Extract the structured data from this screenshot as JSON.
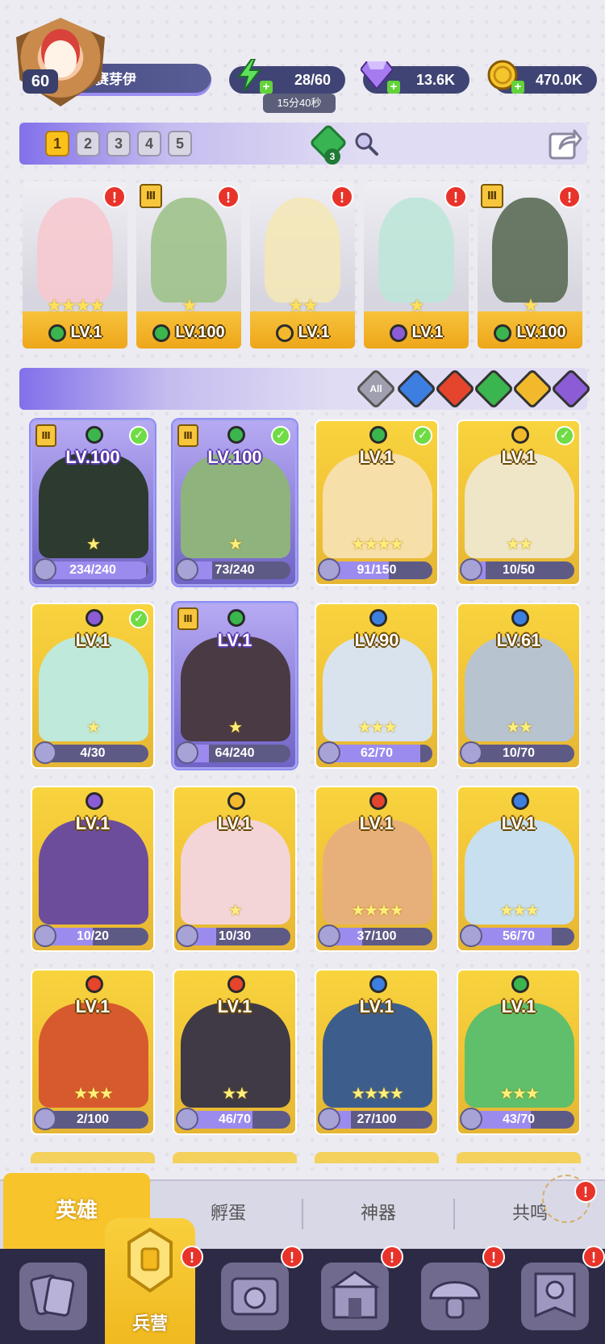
{
  "player": {
    "level": "60",
    "name": "赛芽伊"
  },
  "resources": {
    "energy": "28/60",
    "energy_timer": "15分40秒",
    "gems": "13.6K",
    "gold": "470.0K"
  },
  "team_tabs": [
    "1",
    "2",
    "3",
    "4",
    "5"
  ],
  "team_gem_count": "3",
  "team": [
    {
      "level": "LV.1",
      "stars": "★★★★",
      "element_color": "#3bb54e",
      "art_color": "#f6c9cf",
      "alert": true,
      "rank": ""
    },
    {
      "level": "LV.100",
      "stars": "★",
      "element_color": "#3bb54e",
      "art_color": "#9fc38b",
      "alert": true,
      "rank": "Ⅲ"
    },
    {
      "level": "LV.1",
      "stars": "★★",
      "element_color": "#f2b92c",
      "art_color": "#f4e7b7",
      "alert": true,
      "rank": ""
    },
    {
      "level": "LV.1",
      "stars": "★",
      "element_color": "#8b5cd6",
      "art_color": "#bfe6d9",
      "alert": true,
      "rank": ""
    },
    {
      "level": "LV.100",
      "stars": "★",
      "element_color": "#3bb54e",
      "art_color": "#5a6b55",
      "alert": true,
      "rank": "Ⅲ"
    }
  ],
  "filter": {
    "all_label": "All",
    "elements": [
      "#3d7fe0",
      "#e4452c",
      "#3bb54e",
      "#f2b92c",
      "#8b5cd6"
    ]
  },
  "heroes": [
    {
      "level": "LV.100",
      "fragments": "234/240",
      "progress": 0.975,
      "stars": "★",
      "element_color": "#3bb54e",
      "owned": true,
      "checked": true,
      "rank": "Ⅲ",
      "art_color": "#2c3a30"
    },
    {
      "level": "LV.100",
      "fragments": "73/240",
      "progress": 0.3,
      "stars": "★",
      "element_color": "#3bb54e",
      "owned": true,
      "checked": true,
      "rank": "Ⅲ",
      "art_color": "#8fb37d"
    },
    {
      "level": "LV.1",
      "fragments": "91/150",
      "progress": 0.61,
      "stars": "★★★★",
      "element_color": "#3bb54e",
      "owned": false,
      "checked": true,
      "rank": "",
      "art_color": "#f7dfa9"
    },
    {
      "level": "LV.1",
      "fragments": "10/50",
      "progress": 0.2,
      "stars": "★★",
      "element_color": "#f2b92c",
      "owned": false,
      "checked": true,
      "rank": "",
      "art_color": "#efe6c8"
    },
    {
      "level": "LV.1",
      "fragments": "4/30",
      "progress": 0.13,
      "stars": "★",
      "element_color": "#8b5cd6",
      "owned": false,
      "checked": true,
      "rank": "",
      "art_color": "#bfe9db"
    },
    {
      "level": "LV.1",
      "fragments": "64/240",
      "progress": 0.27,
      "stars": "★",
      "element_color": "#3bb54e",
      "owned": true,
      "checked": false,
      "rank": "Ⅲ",
      "art_color": "#4a3a44"
    },
    {
      "level": "LV.90",
      "fragments": "62/70",
      "progress": 0.89,
      "stars": "★★★",
      "element_color": "#3d7fe0",
      "owned": false,
      "checked": false,
      "rank": "",
      "art_color": "#d9e3ee"
    },
    {
      "level": "LV.61",
      "fragments": "10/70",
      "progress": 0.14,
      "stars": "★★",
      "element_color": "#3d7fe0",
      "owned": false,
      "checked": false,
      "rank": "",
      "art_color": "#b7c3cf"
    },
    {
      "level": "LV.1",
      "fragments": "10/20",
      "progress": 0.5,
      "stars": "",
      "element_color": "#8b5cd6",
      "owned": false,
      "checked": false,
      "rank": "",
      "art_color": "#6c4d9c"
    },
    {
      "level": "LV.1",
      "fragments": "10/30",
      "progress": 0.33,
      "stars": "★",
      "element_color": "#f2b92c",
      "owned": false,
      "checked": false,
      "rank": "",
      "art_color": "#f3d5d8"
    },
    {
      "level": "LV.1",
      "fragments": "37/100",
      "progress": 0.37,
      "stars": "★★★★",
      "element_color": "#e4452c",
      "owned": false,
      "checked": false,
      "rank": "",
      "art_color": "#e7b07a"
    },
    {
      "level": "LV.1",
      "fragments": "56/70",
      "progress": 0.8,
      "stars": "★★★",
      "element_color": "#3d7fe0",
      "owned": false,
      "checked": false,
      "rank": "",
      "art_color": "#c7dfee"
    },
    {
      "level": "LV.1",
      "fragments": "2/100",
      "progress": 0.02,
      "stars": "★★★",
      "element_color": "#e4452c",
      "owned": false,
      "checked": false,
      "rank": "",
      "art_color": "#d65a2e"
    },
    {
      "level": "LV.1",
      "fragments": "46/70",
      "progress": 0.66,
      "stars": "★★",
      "element_color": "#e4452c",
      "owned": false,
      "checked": false,
      "rank": "",
      "art_color": "#3f3a45"
    },
    {
      "level": "LV.1",
      "fragments": "27/100",
      "progress": 0.27,
      "stars": "★★★★",
      "element_color": "#3d7fe0",
      "owned": false,
      "checked": false,
      "rank": "",
      "art_color": "#3d5e8c"
    },
    {
      "level": "LV.1",
      "fragments": "43/70",
      "progress": 0.61,
      "stars": "★★★",
      "element_color": "#3bb54e",
      "owned": false,
      "checked": false,
      "rank": "",
      "art_color": "#5fbf6a"
    }
  ],
  "sub_tabs": [
    "英雄",
    "孵蛋",
    "神器",
    "共鸣"
  ],
  "bottom_nav": {
    "active_label": "兵营",
    "alert_mark": "!"
  },
  "icons": {
    "energy": "lightning-icon",
    "gems": "gem-icon",
    "gold": "coin-icon",
    "search": "search-icon",
    "share": "share-icon",
    "check": "✓",
    "alert": "!"
  }
}
